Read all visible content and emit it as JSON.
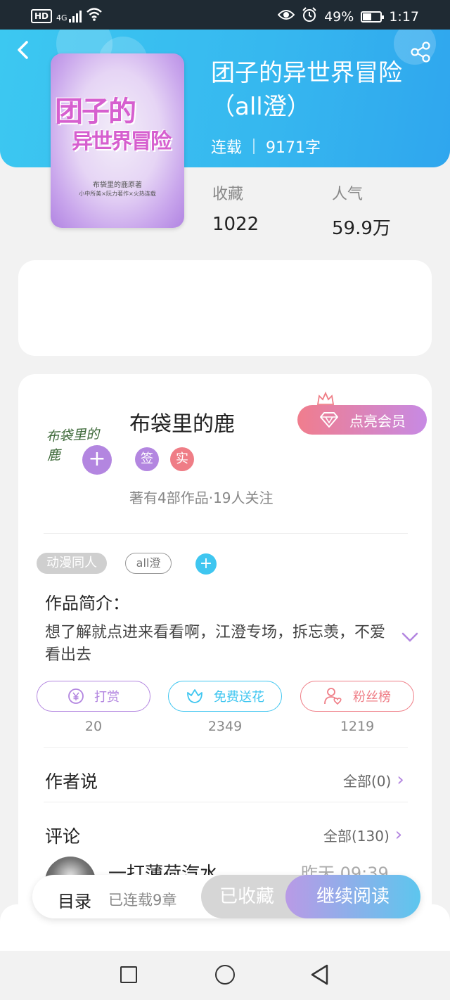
{
  "status_bar": {
    "network_badge": "HD",
    "signal_type": "4G",
    "battery": "49%",
    "time": "1:17"
  },
  "book": {
    "title": "团子的异世界冒险（all澄）",
    "status": "连载",
    "word_count": "9171字",
    "cover": {
      "title_line1": "团子的",
      "title_line2": "异世界冒险",
      "sub_line1": "布袋里的鹿原著",
      "sub_line2": "小中所美×阮力著作×火热连载"
    }
  },
  "stats": {
    "favorites_label": "收藏",
    "favorites_value": "1022",
    "popularity_label": "人气",
    "popularity_value": "59.9万"
  },
  "author": {
    "avatar_text": "布袋里的鹿",
    "name": "布袋里的鹿",
    "badge_sign": "签",
    "badge_real": "实",
    "stats": "著有4部作品·19人关注",
    "vip_button": "点亮会员"
  },
  "tags": {
    "category": "动漫同人",
    "tag": "all澄"
  },
  "intro": {
    "label": "作品简介：",
    "text": "想了解就点进来看看啊，江澄专场，拆忘羡，不爱看出去"
  },
  "actions": [
    {
      "label": "打赏",
      "count": "20",
      "color": "#b386e0"
    },
    {
      "label": "免费送花",
      "count": "2349",
      "color": "#3fc6f0"
    },
    {
      "label": "粉丝榜",
      "count": "1219",
      "color": "#ef7d86"
    }
  ],
  "author_says": {
    "label": "作者说",
    "all": "全部(0)"
  },
  "comments": {
    "label": "评论",
    "all": "全部(130)",
    "first_user": "一打薄荷汽水",
    "first_time": "昨天 09:39"
  },
  "bottom_bar": {
    "toc_label": "目录",
    "toc_count": "已连载9章",
    "favorited": "已收藏",
    "continue_reading": "继续阅读"
  }
}
